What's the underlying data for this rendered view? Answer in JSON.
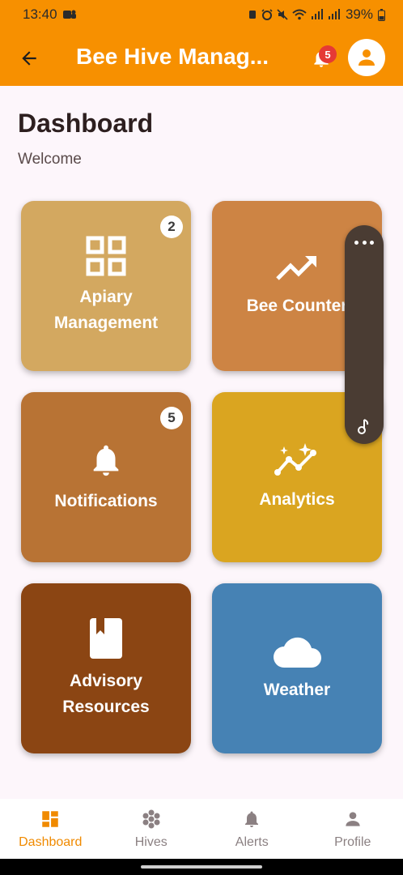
{
  "status": {
    "time": "13:40",
    "battery": "39%"
  },
  "app_bar": {
    "title": "Bee Hive Manag...",
    "notification_count": "5"
  },
  "page": {
    "title": "Dashboard",
    "subtitle": "Welcome"
  },
  "cards": [
    {
      "label": "Apiary\nManagement",
      "icon": "grid-icon",
      "badge": "2",
      "color": "#d3a860"
    },
    {
      "label": "Bee Counter",
      "icon": "trending-up-icon",
      "badge": "",
      "color": "#cd8444"
    },
    {
      "label": "Notifications",
      "icon": "bell-icon",
      "badge": "5",
      "color": "#b87334"
    },
    {
      "label": "Analytics",
      "icon": "analytics-sparkle-icon",
      "badge": "",
      "color": "#daa520"
    },
    {
      "label": "Advisory\nResources",
      "icon": "book-icon",
      "badge": "",
      "color": "#8b4513"
    },
    {
      "label": "Weather",
      "icon": "cloud-icon",
      "badge": "",
      "color": "#4682b4"
    }
  ],
  "bottom_nav": [
    {
      "label": "Dashboard",
      "icon": "dashboard-icon",
      "active": true
    },
    {
      "label": "Hives",
      "icon": "hive-icon",
      "active": false
    },
    {
      "label": "Alerts",
      "icon": "bell-icon",
      "active": false
    },
    {
      "label": "Profile",
      "icon": "person-icon",
      "active": false
    }
  ],
  "colors": {
    "primary": "#f79000",
    "active_nav": "#f08a00",
    "inactive_nav": "#8b8082",
    "background": "#fdf6fb"
  }
}
